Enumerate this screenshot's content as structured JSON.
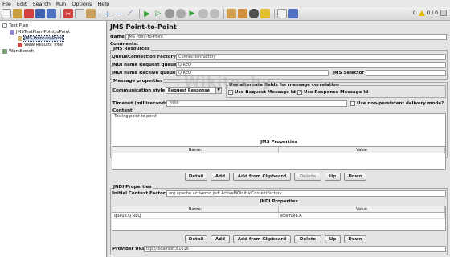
{
  "menu": [
    "File",
    "Edit",
    "Search",
    "Run",
    "Options",
    "Help"
  ],
  "toolbar": {
    "icons": [
      "new-icon",
      "templates-icon",
      "open-icon",
      "save-icon",
      "save-as-icon",
      "cut-icon",
      "copy-icon",
      "paste-icon",
      "expand-icon",
      "collapse-icon",
      "toggle-icon",
      "start-icon",
      "start-no-pause-icon",
      "stop-icon",
      "shutdown-icon",
      "remote-start-icon",
      "remote-stop-icon",
      "remote-shutdown-icon",
      "clear-icon",
      "clear-all-icon",
      "search-icon",
      "reset-search-icon",
      "function-helper-icon",
      "help-icon"
    ],
    "warning_count": "0",
    "thread_count": "0 / 0"
  },
  "tree": {
    "items": [
      {
        "label": "Test Plan",
        "indent": 0
      },
      {
        "label": "JMSTestPlan-PointtoPoint",
        "indent": 1
      },
      {
        "label": "JMS Point-to-Point",
        "indent": 2
      },
      {
        "label": "View Results Tree",
        "indent": 2
      },
      {
        "label": "WorkBench",
        "indent": 0
      }
    ]
  },
  "panel": {
    "title": "JMS Point-to-Point",
    "name_label": "Name:",
    "name_value": "JMS Point-to-Point",
    "comments_label": "Comments:",
    "jms_resources": {
      "title": "JMS Resources",
      "qcf_label": "QueueConnection Factory",
      "qcf_value": "ConnectionFactory",
      "req_queue_label": "JNDI name Request queue",
      "req_queue_value": "Q.REQ",
      "recv_queue_label": "JNDI name Receive queue",
      "recv_queue_value": "Q.REQ",
      "selector_label": "JMS Selector",
      "selector_value": ""
    },
    "message_props": {
      "title": "Message properties",
      "comm_style_label": "Communication style",
      "comm_style_value": "Request Response",
      "alt_fields_title": "Use alternate fields for message correlation",
      "use_req_id": "Use Request Message Id",
      "use_resp_id": "Use Response Message Id",
      "timeout_label": "Timeout (milliseconds)",
      "timeout_value": "2000",
      "non_persistent": "Use non-persistent delivery mode?",
      "content_label": "Content",
      "content_value": "Testing point to point"
    },
    "jms_properties": {
      "title": "JMS Properties",
      "columns": [
        "Name:",
        "Value"
      ],
      "buttons": [
        "Detail",
        "Add",
        "Add from Clipboard",
        "Delete",
        "Up",
        "Down"
      ]
    },
    "jndi": {
      "title": "JNDI Properties",
      "icf_label": "Initial Context Factory",
      "icf_value": "org.apache.activemq.jndi.ActiveMQInitialContextFactory",
      "table_title": "JNDI Properties",
      "columns": [
        "Name:",
        "Value"
      ],
      "rows": [
        [
          "queue.Q.REQ",
          "example.A"
        ]
      ],
      "buttons": [
        "Detail",
        "Add",
        "Add from Clipboard",
        "Delete",
        "Up",
        "Down"
      ],
      "provider_label": "Provider URL",
      "provider_value": "tcp://localhost:61616"
    }
  },
  "watermark": "Wikitechy"
}
